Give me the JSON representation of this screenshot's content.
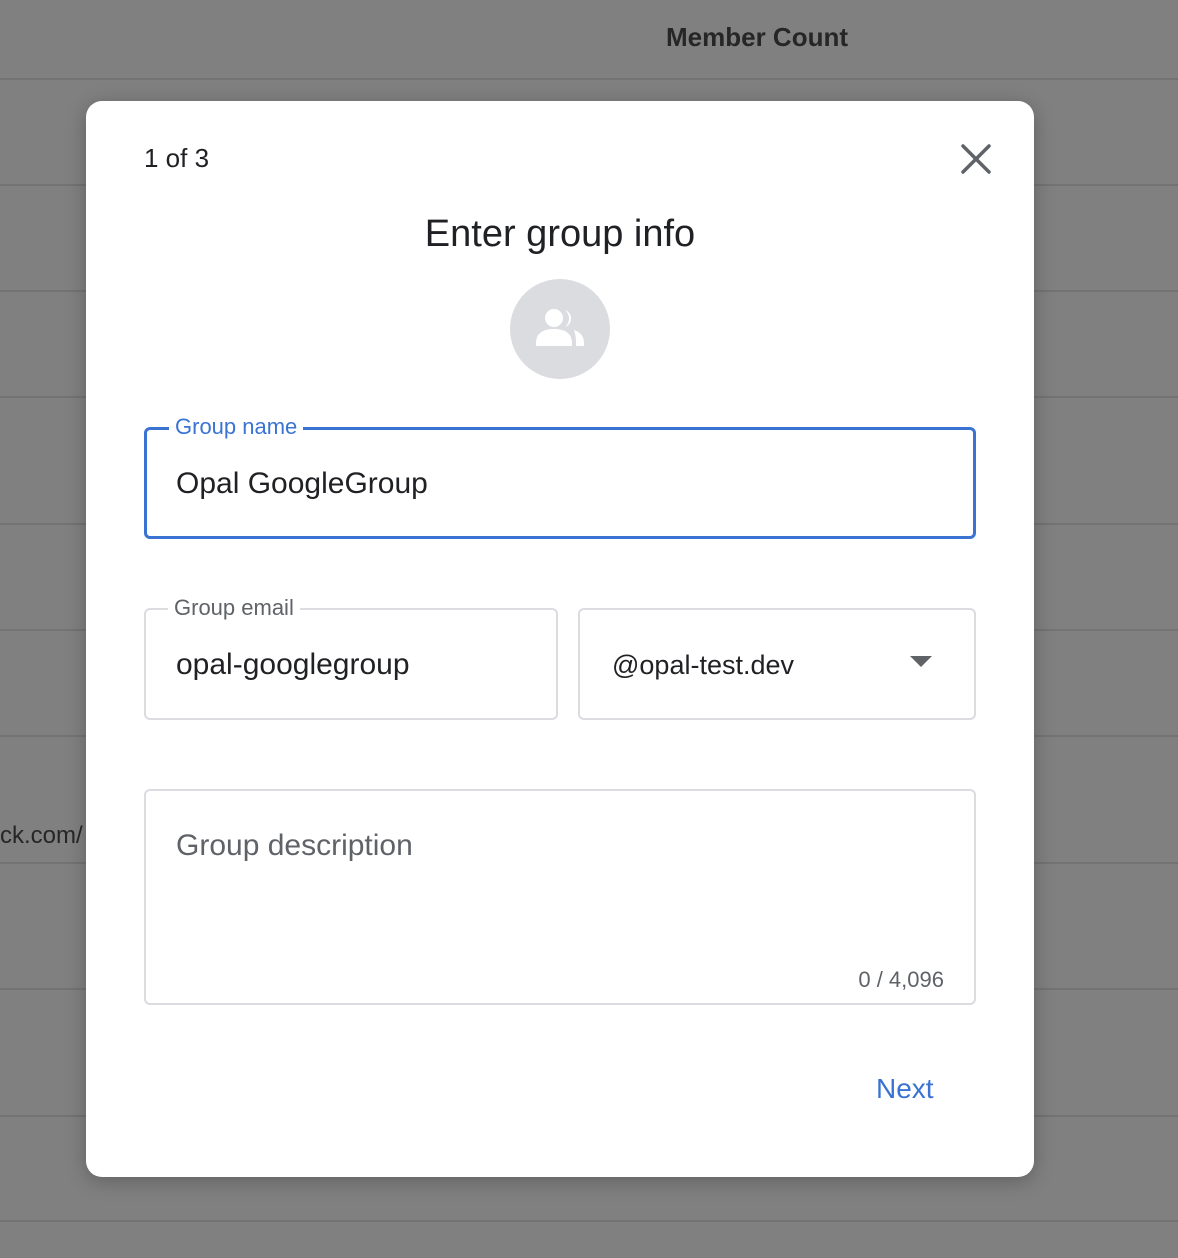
{
  "background": {
    "column_header": "Member Count",
    "cell_fragment": "ck.com/"
  },
  "dialog": {
    "step_indicator": "1 of 3",
    "title": "Enter group info",
    "avatar_icon": "group-icon",
    "close_icon": "close-icon",
    "group_name": {
      "label": "Group name",
      "value": "Opal GoogleGroup"
    },
    "group_email": {
      "label": "Group email",
      "value": "opal-googlegroup"
    },
    "domain": {
      "selected": "@opal-test.dev",
      "icon": "dropdown-arrow-icon"
    },
    "group_description": {
      "placeholder": "Group description",
      "value": "",
      "counter": "0 / 4,096"
    },
    "next_label": "Next"
  },
  "colors": {
    "accent": "#3b73d3",
    "backdrop": "#808080",
    "avatar_bg": "#dadce0"
  }
}
